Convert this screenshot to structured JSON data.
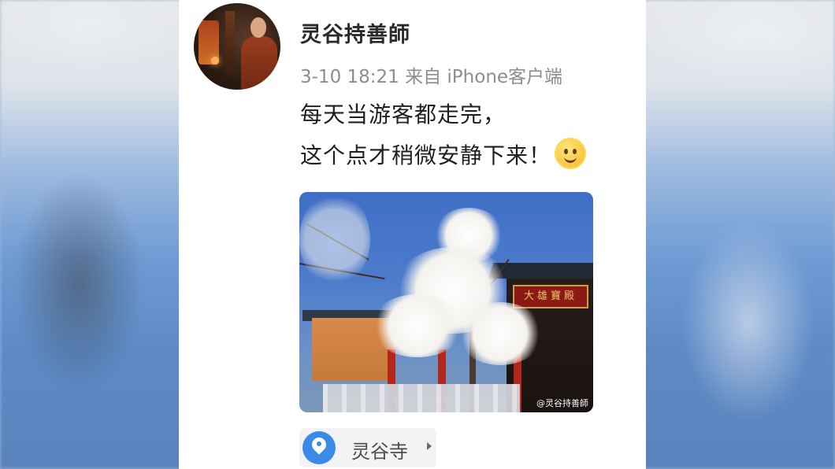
{
  "post": {
    "author_name": "灵谷持善師",
    "meta": "3-10 18:21 来自 iPhone客户端",
    "text_line_1": "每天当游客都走完，",
    "text_line_2": "这个点才稍微安静下来！",
    "emoji": "smiling-sun-emoji",
    "photo": {
      "plaque_text": "大雄寶殿",
      "watermark": "@灵谷持善師"
    },
    "location": {
      "label": "灵谷寺",
      "icon": "location-pin-icon"
    }
  },
  "colors": {
    "card_background": "#ffffff",
    "author_name": "#2a2a2a",
    "meta_text": "#8d8d8d",
    "location_pin": "#3a8ae6",
    "location_chip": "#f3f3f4"
  }
}
